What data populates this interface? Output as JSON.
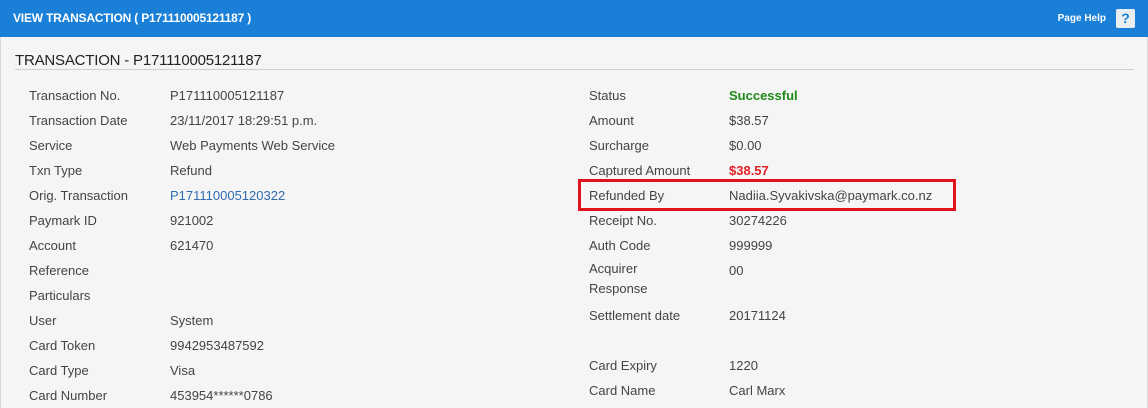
{
  "header": {
    "title": "VIEW TRANSACTION ( P171110005121187 )",
    "help_label": "Page Help",
    "help_icon": "?"
  },
  "section_title": "TRANSACTION - P171110005121187",
  "left_fields": [
    {
      "label": "Transaction No.",
      "value": "P171110005121187"
    },
    {
      "label": "Transaction Date",
      "value": "23/11/2017 18:29:51 p.m."
    },
    {
      "label": "Service",
      "value": "Web Payments Web Service"
    },
    {
      "label": "Txn Type",
      "value": "Refund"
    },
    {
      "label": "Orig. Transaction",
      "value": "P171110005120322"
    },
    {
      "label": "Paymark ID",
      "value": "921002"
    },
    {
      "label": "Account",
      "value": "621470"
    },
    {
      "label": "Reference",
      "value": ""
    },
    {
      "label": "Particulars",
      "value": ""
    },
    {
      "label": "User",
      "value": "System"
    },
    {
      "label": "Card Token",
      "value": "9942953487592"
    },
    {
      "label": "Card Type",
      "value": "Visa"
    },
    {
      "label": "Card Number",
      "value": "453954******0786"
    }
  ],
  "right_fields": [
    {
      "label": "Status",
      "value": "Successful"
    },
    {
      "label": "Amount",
      "value": "$38.57"
    },
    {
      "label": "Surcharge",
      "value": "$0.00"
    },
    {
      "label": "Captured Amount",
      "value": "$38.57"
    },
    {
      "label": "Refunded By",
      "value": "Nadiia.Syvakivska@paymark.co.nz"
    },
    {
      "label": "Receipt No.",
      "value": "30274226"
    },
    {
      "label": "Auth Code",
      "value": "999999"
    },
    {
      "label": "Acquirer Response",
      "value": "00"
    },
    {
      "label": "Settlement date",
      "value": "20171124"
    },
    {
      "label": "Card Expiry",
      "value": "1220"
    },
    {
      "label": "Card Name",
      "value": "Carl Marx"
    }
  ],
  "colors": {
    "header_bg": "#1a7fd6",
    "success": "#1f8a18",
    "alert": "#e01f26",
    "link": "#2f6bb0",
    "highlight_border": "#e0131c"
  },
  "icons": {
    "help": "help-icon"
  }
}
